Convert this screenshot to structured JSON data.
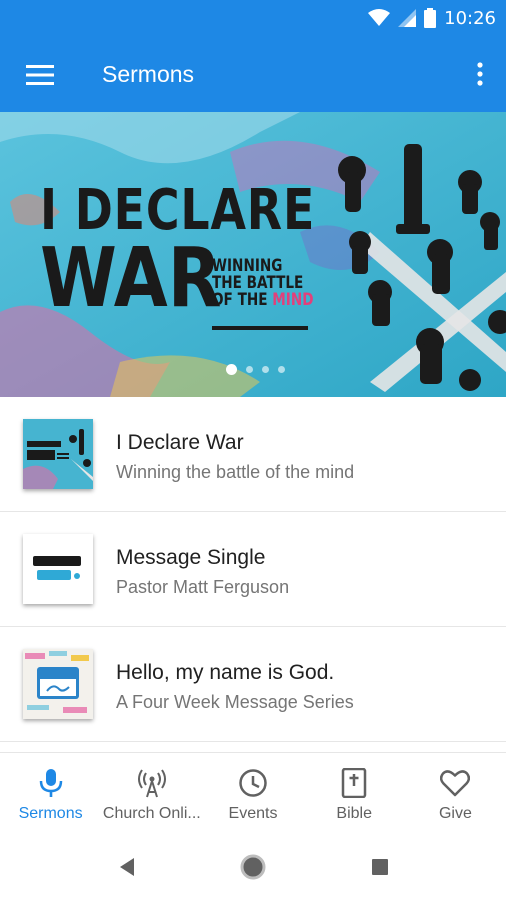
{
  "status": {
    "time": "10:26"
  },
  "appbar": {
    "title": "Sermons"
  },
  "banner": {
    "line1": "I DECLARE",
    "line2": "WAR",
    "sub1": "WINNING",
    "sub2": "THE BATTLE",
    "sub3_prefix": "OF THE ",
    "sub3_highlight": "MIND",
    "slides": 4,
    "active_slide": 1
  },
  "sermons": [
    {
      "title": "I Declare War",
      "subtitle": "Winning the battle of the mind"
    },
    {
      "title": "Message Single",
      "subtitle": "Pastor Matt Ferguson"
    },
    {
      "title": "Hello, my name is God.",
      "subtitle": "A Four Week Message Series"
    }
  ],
  "nav": {
    "items": [
      {
        "label": "Sermons",
        "icon": "mic-icon",
        "active": true
      },
      {
        "label": "Church Onli...",
        "icon": "broadcast-icon",
        "active": false
      },
      {
        "label": "Events",
        "icon": "clock-icon",
        "active": false
      },
      {
        "label": "Bible",
        "icon": "bible-icon",
        "active": false
      },
      {
        "label": "Give",
        "icon": "heart-icon",
        "active": false
      }
    ]
  },
  "colors": {
    "primary": "#1e88e5",
    "accent_pink": "#e2407b",
    "banner_bg": "#43b2cf"
  }
}
